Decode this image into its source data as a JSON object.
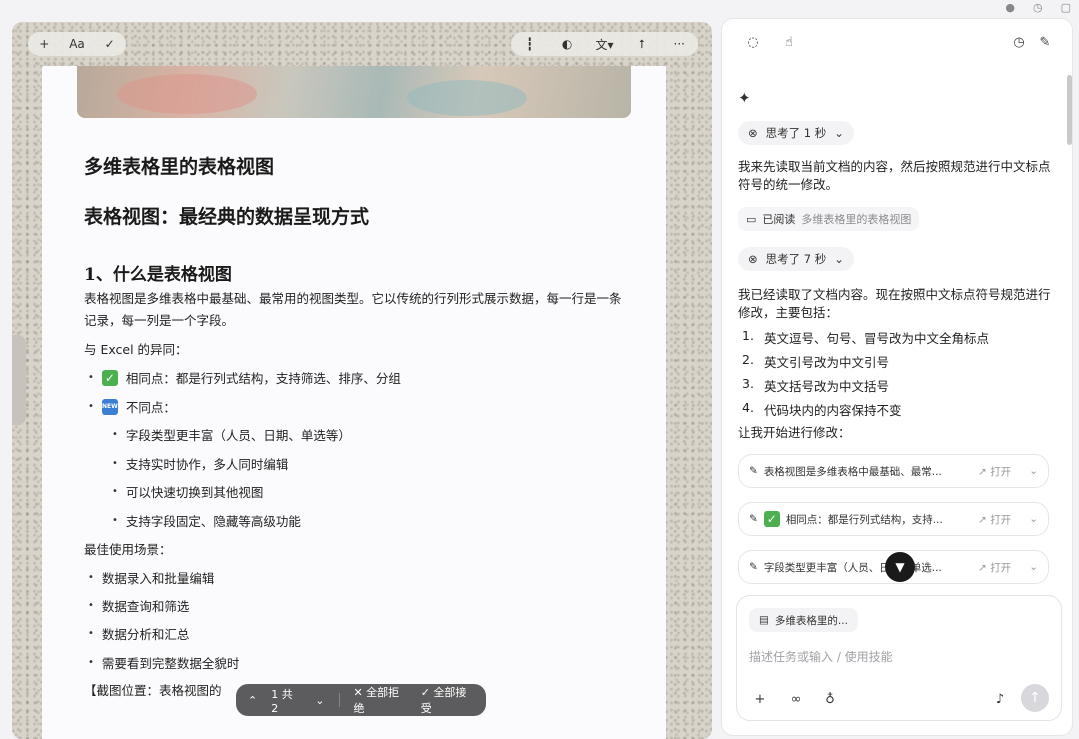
{
  "window": {
    "icons": [
      "avatar-icon",
      "history-icon",
      "window-icon"
    ]
  },
  "doc_toolbar": {
    "left": [
      {
        "name": "add-icon",
        "label": "+"
      },
      {
        "name": "text-format-icon",
        "label": "Aa"
      },
      {
        "name": "pen-icon",
        "label": "✓"
      }
    ],
    "right": [
      {
        "name": "voice-icon",
        "label": "┇"
      },
      {
        "name": "palette-icon",
        "label": "◐"
      },
      {
        "name": "translate-icon",
        "label": "文▾"
      },
      {
        "name": "share-icon",
        "label": "⭡"
      },
      {
        "name": "more-icon",
        "label": "···"
      }
    ]
  },
  "document": {
    "title": "多维表格里的表格视图",
    "heading2": "表格视图：最经典的数据呈现方式",
    "heading3": "1、什么是表格视图",
    "intro": "表格视图是多维表格中最基础、最常用的视图类型。它以传统的行列形式展示数据，每一行是一条记录，每一列是一个字段。",
    "excel_label": "与 Excel 的异同：",
    "same": "相同点：都是行列式结构，支持筛选、排序、分组",
    "diff_label": "不同点：",
    "diff_items": [
      "字段类型更丰富（人员、日期、单选等）",
      "支持实时协作，多人同时编辑",
      "可以快速切换到其他视图",
      "支持字段固定、隐藏等高级功能"
    ],
    "scene_label": "最佳使用场景：",
    "scene_items": [
      "数据录入和批量编辑",
      "数据查询和筛选",
      "数据分析和汇总",
      "需要看到完整数据全貌时"
    ],
    "screenshot_note": "【截图位置：表格视图的"
  },
  "float_bar": {
    "counter": "1 共 2",
    "reject_all": "全部拒绝",
    "accept_all": "全部接受"
  },
  "panel": {
    "think1": "思考了 1 秒",
    "msg1": "我来先读取当前文档的内容，然后按照规范进行中文标点符号的统一修改。",
    "read_label": "已阅读",
    "read_doc": "多维表格里的表格视图",
    "think2": "思考了 7 秒",
    "msg2": "我已经读取了文档内容。现在按照中文标点符号规范进行修改，主要包括：",
    "list": [
      {
        "num": "1.",
        "text": "英文逗号、句号、冒号改为中文全角标点"
      },
      {
        "num": "2.",
        "text": "英文引号改为中文引号"
      },
      {
        "num": "3.",
        "text": "英文括号改为中文括号"
      },
      {
        "num": "4.",
        "text": "代码块内的内容保持不变"
      }
    ],
    "msg3": "让我开始进行修改：",
    "edits": [
      {
        "text": "表格视图是多维表格中最基础、最常...",
        "open": "打开"
      },
      {
        "text": "相同点：都是行列式结构，支持...",
        "open": "打开"
      },
      {
        "text": "字段类型更丰富（人员、日期、单选...",
        "open": "打开"
      }
    ],
    "input": {
      "doc_chip": "多维表格里的...",
      "placeholder": "描述任务或输入 / 使用技能"
    }
  }
}
